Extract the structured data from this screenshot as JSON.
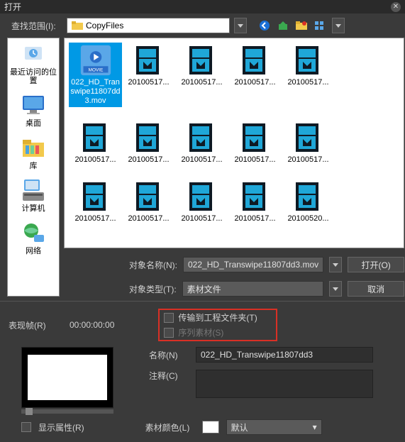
{
  "title": "打开",
  "lookin": {
    "label": "查找范围(I):",
    "value": "CopyFiles"
  },
  "places": [
    {
      "label": "最近访问的位置",
      "icon": "recent"
    },
    {
      "label": "桌面",
      "icon": "desktop"
    },
    {
      "label": "库",
      "icon": "library"
    },
    {
      "label": "计算机",
      "icon": "computer"
    },
    {
      "label": "网络",
      "icon": "network"
    }
  ],
  "files": [
    {
      "label": "022_HD_Transwipe11807dd3.mov",
      "selected": true,
      "type": "movie"
    },
    {
      "label": "20100517...",
      "type": "doc"
    },
    {
      "label": "20100517...",
      "type": "doc"
    },
    {
      "label": "20100517...",
      "type": "doc"
    },
    {
      "label": "20100517...",
      "type": "doc"
    },
    {
      "label": "20100517...",
      "type": "doc"
    },
    {
      "label": "20100517...",
      "type": "doc"
    },
    {
      "label": "20100517...",
      "type": "doc"
    },
    {
      "label": "20100517...",
      "type": "doc"
    },
    {
      "label": "20100517...",
      "type": "doc"
    },
    {
      "label": "20100517...",
      "type": "doc"
    },
    {
      "label": "20100517...",
      "type": "doc"
    },
    {
      "label": "20100517...",
      "type": "doc"
    },
    {
      "label": "20100517...",
      "type": "doc"
    },
    {
      "label": "20100520...",
      "type": "doc"
    }
  ],
  "object_name": {
    "label": "对象名称(N):",
    "value": "022_HD_Transwipe11807dd3.mov"
  },
  "object_type": {
    "label": "对象类型(T):",
    "value": "素材文件"
  },
  "open_btn": "打开(O)",
  "cancel_btn": "取消",
  "preview_frame": {
    "label": "表现帧(R)",
    "timecode": "00:00:00:00"
  },
  "transfer_label": "传输到工程文件夹(T)",
  "sequence_label": "序列素材(S)",
  "name_field": {
    "label": "名称(N)",
    "value": "022_HD_Transwipe11807dd3"
  },
  "comment_field": {
    "label": "注释(C)"
  },
  "show_attr_label": "显示属性(R)",
  "clip_color": {
    "label": "素材颜色(L)",
    "value": "默认"
  }
}
